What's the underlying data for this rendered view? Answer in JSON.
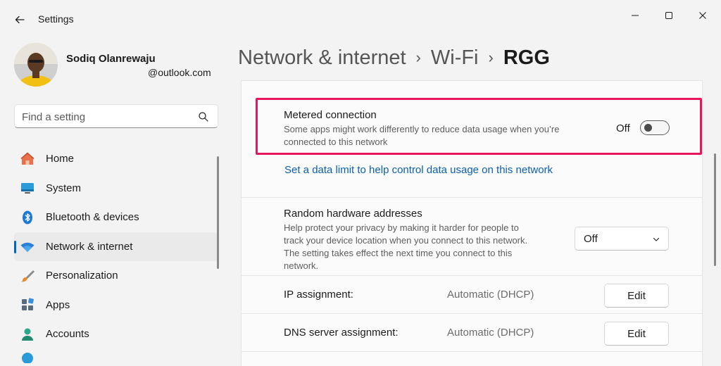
{
  "window": {
    "title": "Settings",
    "controls": [
      "minimize-icon",
      "maximize-icon",
      "close-icon"
    ]
  },
  "profile": {
    "name": "Sodiq Olanrewaju",
    "email": "@outlook.com"
  },
  "search": {
    "placeholder": "Find a setting"
  },
  "sidebar": {
    "items": [
      {
        "label": "Home",
        "icon": "home-icon"
      },
      {
        "label": "System",
        "icon": "system-icon"
      },
      {
        "label": "Bluetooth & devices",
        "icon": "bluetooth-icon"
      },
      {
        "label": "Network & internet",
        "icon": "wifi-icon",
        "active": true
      },
      {
        "label": "Personalization",
        "icon": "brush-icon"
      },
      {
        "label": "Apps",
        "icon": "apps-icon"
      },
      {
        "label": "Accounts",
        "icon": "accounts-icon"
      }
    ]
  },
  "breadcrumb": {
    "items": [
      "Network & internet",
      "Wi-Fi"
    ],
    "current": "RGG"
  },
  "settings": {
    "metered": {
      "title": "Metered connection",
      "desc_line1": "Some apps might work differently to reduce data usage when you’re",
      "desc_line2": "connected to this network",
      "toggle_state": "Off",
      "toggle_on": false
    },
    "data_limit_link": "Set a data limit to help control data usage on this network",
    "random_hw": {
      "title": "Random hardware addresses",
      "desc_line1": "Help protect your privacy by making it harder for people to",
      "desc_line2": "track your device location when you connect to this network.",
      "desc_line3": "The setting takes effect the next time you connect to this",
      "desc_line4": "network.",
      "value": "Off"
    },
    "ip": {
      "label": "IP assignment:",
      "value": "Automatic (DHCP)",
      "button": "Edit"
    },
    "dns": {
      "label": "DNS server assignment:",
      "value": "Automatic (DHCP)",
      "button": "Edit"
    }
  },
  "colors": {
    "accent": "#0067c0",
    "highlight_border": "#e8175d",
    "link": "#0a5fb4"
  }
}
